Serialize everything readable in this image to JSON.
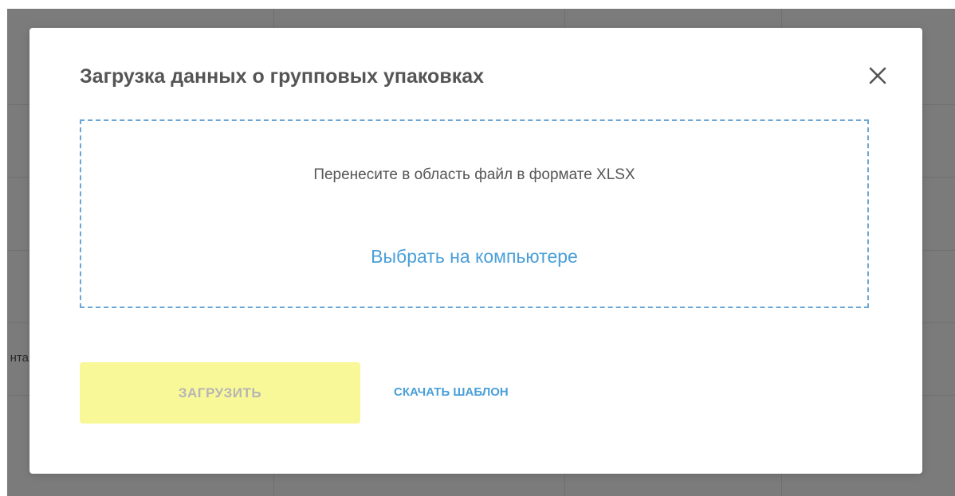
{
  "background": {
    "fragment_text": "нта"
  },
  "modal": {
    "title": "Загрузка данных о групповых упаковках",
    "close_icon": "close-icon",
    "dropzone": {
      "hint": "Перенесите в область файл в формате XLSX",
      "choose_label": "Выбрать на компьютере"
    },
    "upload_label": "ЗАГРУЗИТЬ",
    "template_label": "СКАЧАТЬ ШАБЛОН"
  },
  "colors": {
    "overlay": "#7b7b7b",
    "accent_link": "#4a9fd8",
    "dropzone_border": "#6aa7d8",
    "upload_button_bg": "#f9f898",
    "upload_button_text": "#b5b5b5",
    "title_text": "#555555"
  }
}
